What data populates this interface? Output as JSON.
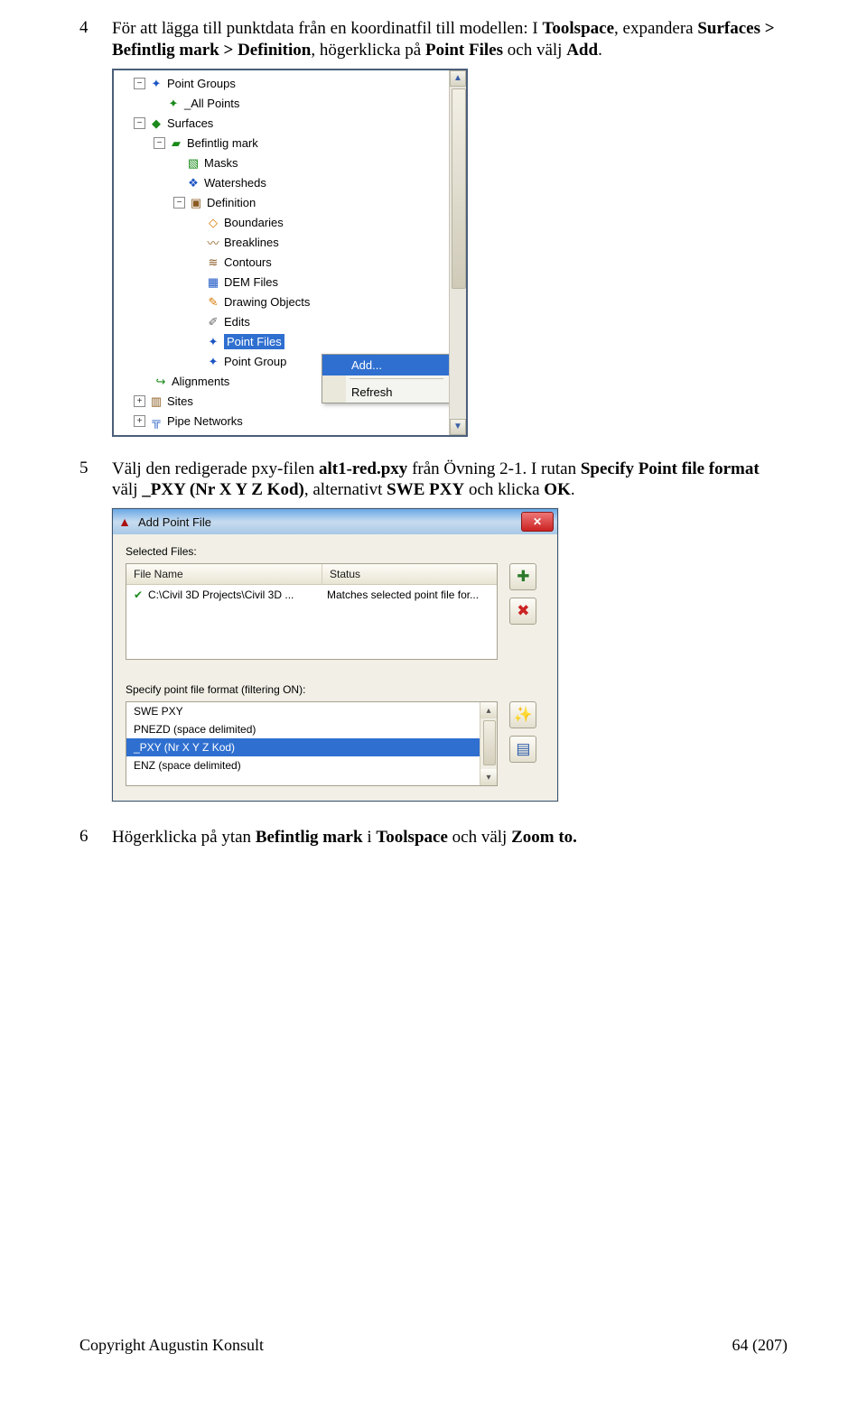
{
  "steps": {
    "s4_num": "4",
    "s4_a": "För att lägga till punktdata från en koordinatfil till modellen: I ",
    "s4_b": "Toolspace",
    "s4_c": ", expandera ",
    "s4_d": "Surfaces > Befintlig mark > Definition",
    "s4_e": ", högerklicka på ",
    "s4_f": "Point Files",
    "s4_g": " och välj ",
    "s4_h": "Add",
    "s4_i": ".",
    "s5_num": "5",
    "s5_a": "Välj den redigerade pxy-filen ",
    "s5_b": "alt1-red.pxy",
    "s5_c": " från Övning 2-1. I rutan ",
    "s5_d": "Specify Point file format",
    "s5_e": " välj ",
    "s5_f": "_PXY (Nr X Y Z Kod)",
    "s5_g": ", alternativt ",
    "s5_h": "SWE PXY",
    "s5_i": " och klicka ",
    "s5_j": "OK",
    "s5_k": ".",
    "s6_num": "6",
    "s6_a": "Högerklicka på ytan ",
    "s6_b": "Befintlig mark",
    "s6_c": " i ",
    "s6_d": "Toolspace",
    "s6_e": " och välj ",
    "s6_f": "Zoom to.",
    "s6_g": ""
  },
  "tree": {
    "point_groups": "Point Groups",
    "all_points": "_All Points",
    "surfaces": "Surfaces",
    "befintlig": "Befintlig mark",
    "masks": "Masks",
    "watersheds": "Watersheds",
    "definition": "Definition",
    "boundaries": "Boundaries",
    "breaklines": "Breaklines",
    "contours": "Contours",
    "dem": "DEM Files",
    "drawing": "Drawing Objects",
    "edits": "Edits",
    "point_files": "Point Files",
    "point_grp": "Point Group",
    "alignments": "Alignments",
    "sites": "Sites",
    "pipe": "Pipe Networks"
  },
  "menu": {
    "add": "Add...",
    "refresh": "Refresh"
  },
  "dialog": {
    "title": "Add Point File",
    "selected_files": "Selected Files:",
    "col_file": "File Name",
    "col_status": "Status",
    "row_file": "C:\\Civil 3D Projects\\Civil 3D ...",
    "row_status": "Matches selected point file for...",
    "specify": "Specify point file format (filtering ON):",
    "opt1": "SWE PXY",
    "opt2": "PNEZD (space delimited)",
    "opt3": "_PXY (Nr X Y Z Kod)",
    "opt4": "ENZ (space delimited)"
  },
  "footer": {
    "left": "Copyright Augustin Konsult",
    "center": "64 (207)"
  }
}
